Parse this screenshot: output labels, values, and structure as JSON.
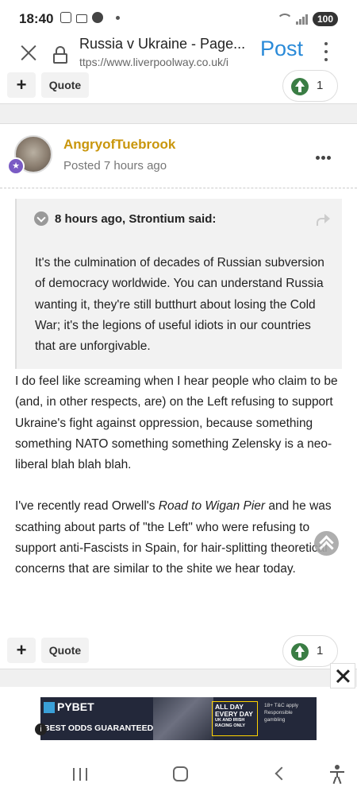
{
  "status_bar": {
    "time": "18:40",
    "battery": "100"
  },
  "browser": {
    "page_title": "Russia v Ukraine - Page...",
    "url": "ttps://www.liverpoolway.co.uk/i",
    "post_label": "Post"
  },
  "top_actions": {
    "plus_label": "+",
    "quote_label": "Quote",
    "reputation": "1"
  },
  "post": {
    "author": "AngryofTuebrook",
    "posted": "Posted 7 hours ago",
    "quote": {
      "citation": "8 hours ago, Strontium said:",
      "text": "It's the culmination of decades of Russian subversion of democracy worldwide. You can understand Russia wanting it, they're still butthurt about losing the Cold War; it's the legions of useful idiots in our countries that are unforgivable."
    },
    "body_p1": "I do feel like screaming when I hear people who claim to be (and, in other respects, are) on the Left refusing to support Ukraine's fight against oppression, because something something NATO something something Zelensky is a neo-liberal blah blah blah.",
    "body_p2_before": "I've recently read Orwell's ",
    "body_p2_book": "Road to Wigan Pier",
    "body_p2_after": " and he was scathing about parts of \"the Left\" who were refusing to support anti-Fascists in Spain, for hair-splitting theoretical concerns that are similar to the shite we hear today."
  },
  "bottom_actions": {
    "plus_label": "+",
    "quote_label": "Quote",
    "reputation": "1"
  },
  "ad": {
    "brand": "PYBET",
    "tagline": "BEST ODDS GUARANTEED",
    "box_line1": "ALL DAY",
    "box_line2": "EVERY DAY",
    "box_line3": "UK AND IRISH",
    "box_line4": "RACING ONLY",
    "right_line1": "18+ T&C apply",
    "right_line2": "Responsible gambling",
    "info": "i"
  },
  "colors": {
    "author": "#c9960c",
    "post_link": "#2a8ad8",
    "reputation_green": "#3a7d44"
  }
}
